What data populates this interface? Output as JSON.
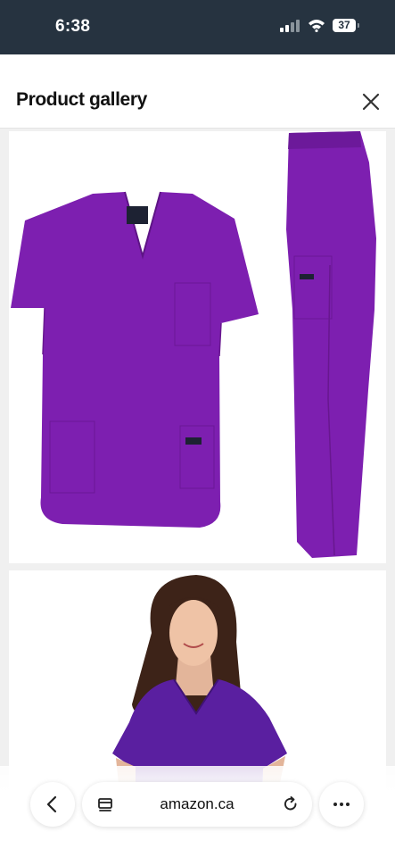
{
  "status_bar": {
    "time": "6:38",
    "battery": "37"
  },
  "sheet": {
    "title": "Product gallery"
  },
  "browser": {
    "url": "amazon.ca"
  },
  "colors": {
    "status_bar_bg": "#263340",
    "scrubs_purple": "#7d1fb0"
  },
  "icons": [
    "signal-icon",
    "wifi-icon",
    "battery-icon",
    "close-icon",
    "back-arrow-icon",
    "tabs-icon",
    "reload-icon",
    "more-icon"
  ]
}
